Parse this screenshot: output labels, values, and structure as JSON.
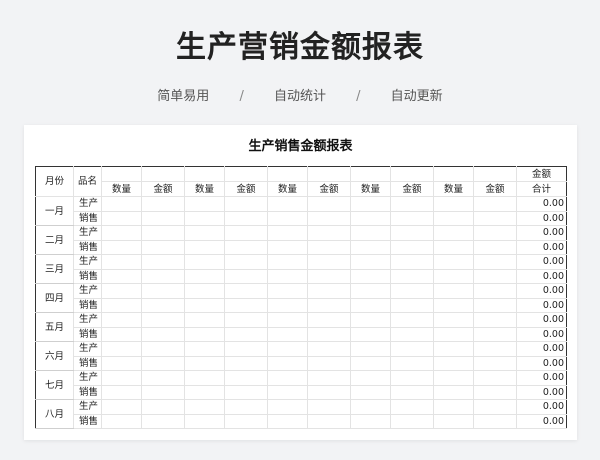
{
  "header": {
    "title": "生产营销金额报表",
    "tags": [
      "简单易用",
      "自动统计",
      "自动更新"
    ],
    "separator": "/"
  },
  "sheet": {
    "title": "生产销售金额报表",
    "col_month": "月份",
    "col_product": "品名",
    "col_qty": "数量",
    "col_amount": "金额",
    "total_top": "金额",
    "total_bottom": "合计",
    "group_count": 5,
    "rows": [
      {
        "month": "一月",
        "produce": "生产",
        "sell": "销售",
        "produce_total": "0.00",
        "sell_total": "0.00"
      },
      {
        "month": "二月",
        "produce": "生产",
        "sell": "销售",
        "produce_total": "0.00",
        "sell_total": "0.00"
      },
      {
        "month": "三月",
        "produce": "生产",
        "sell": "销售",
        "produce_total": "0.00",
        "sell_total": "0.00"
      },
      {
        "month": "四月",
        "produce": "生产",
        "sell": "销售",
        "produce_total": "0.00",
        "sell_total": "0.00"
      },
      {
        "month": "五月",
        "produce": "生产",
        "sell": "销售",
        "produce_total": "0.00",
        "sell_total": "0.00"
      },
      {
        "month": "六月",
        "produce": "生产",
        "sell": "销售",
        "produce_total": "0.00",
        "sell_total": "0.00"
      },
      {
        "month": "七月",
        "produce": "生产",
        "sell": "销售",
        "produce_total": "0.00",
        "sell_total": "0.00"
      },
      {
        "month": "八月",
        "produce": "生产",
        "sell": "销售",
        "produce_total": "0.00",
        "sell_total": "0.00"
      }
    ]
  }
}
